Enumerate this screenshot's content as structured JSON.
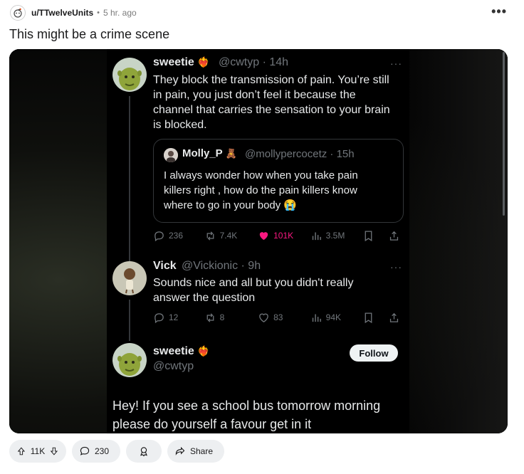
{
  "post": {
    "author": "u/TTwelveUnits",
    "separator": "•",
    "time": "5 hr. ago",
    "more": "•••",
    "title": "This might be a crime scene"
  },
  "tweet1": {
    "name": "sweetie",
    "badge": "❤️‍🔥",
    "handle": "@cwtyp · 14h",
    "more": "···",
    "text_lines": [
      "They block the transmission of pain. You’re still",
      "in pain, you just don’t feel it because the",
      "channel that carries the sensation to your brain",
      "is blocked."
    ]
  },
  "quote": {
    "name": "Molly_P",
    "badge": "🧸",
    "handle": "@mollypercocetz · 15h",
    "text_lines": [
      "I always wonder how when you take pain",
      "killers right , how do the pain killers know",
      "where to go in your body 😭"
    ]
  },
  "actions1": {
    "replies": "236",
    "retweets": "7.4K",
    "likes": "101K",
    "views": "3.5M"
  },
  "tweet2": {
    "name": "Vick",
    "handle": "@Vickionic · 9h",
    "more": "···",
    "text_lines": [
      "Sounds nice and all but you didn't really",
      "answer the question"
    ]
  },
  "actions2": {
    "replies": "12",
    "retweets": "8",
    "likes": "83",
    "views": "94K"
  },
  "tweet3": {
    "name": "sweetie",
    "badge": "❤️‍🔥",
    "handle": "@cwtyp",
    "follow": "Follow",
    "text_lines": [
      "Hey! If you see a school bus tomorrow morning",
      "please do yourself a favour get in it"
    ]
  },
  "bottom": {
    "votes": "11K",
    "comments": "230",
    "share": "Share"
  },
  "colors": {
    "like_pink": "#f91880",
    "muted": "#71767b",
    "text_light": "#e7e9ea",
    "pill_bg": "#edeff1"
  },
  "icons": [
    "snoo-avatar-icon",
    "reply-icon",
    "retweet-icon",
    "heart-icon",
    "views-icon",
    "bookmark-icon",
    "share-tweet-icon",
    "upvote-icon",
    "downvote-icon",
    "comment-icon",
    "award-icon",
    "share-icon"
  ]
}
